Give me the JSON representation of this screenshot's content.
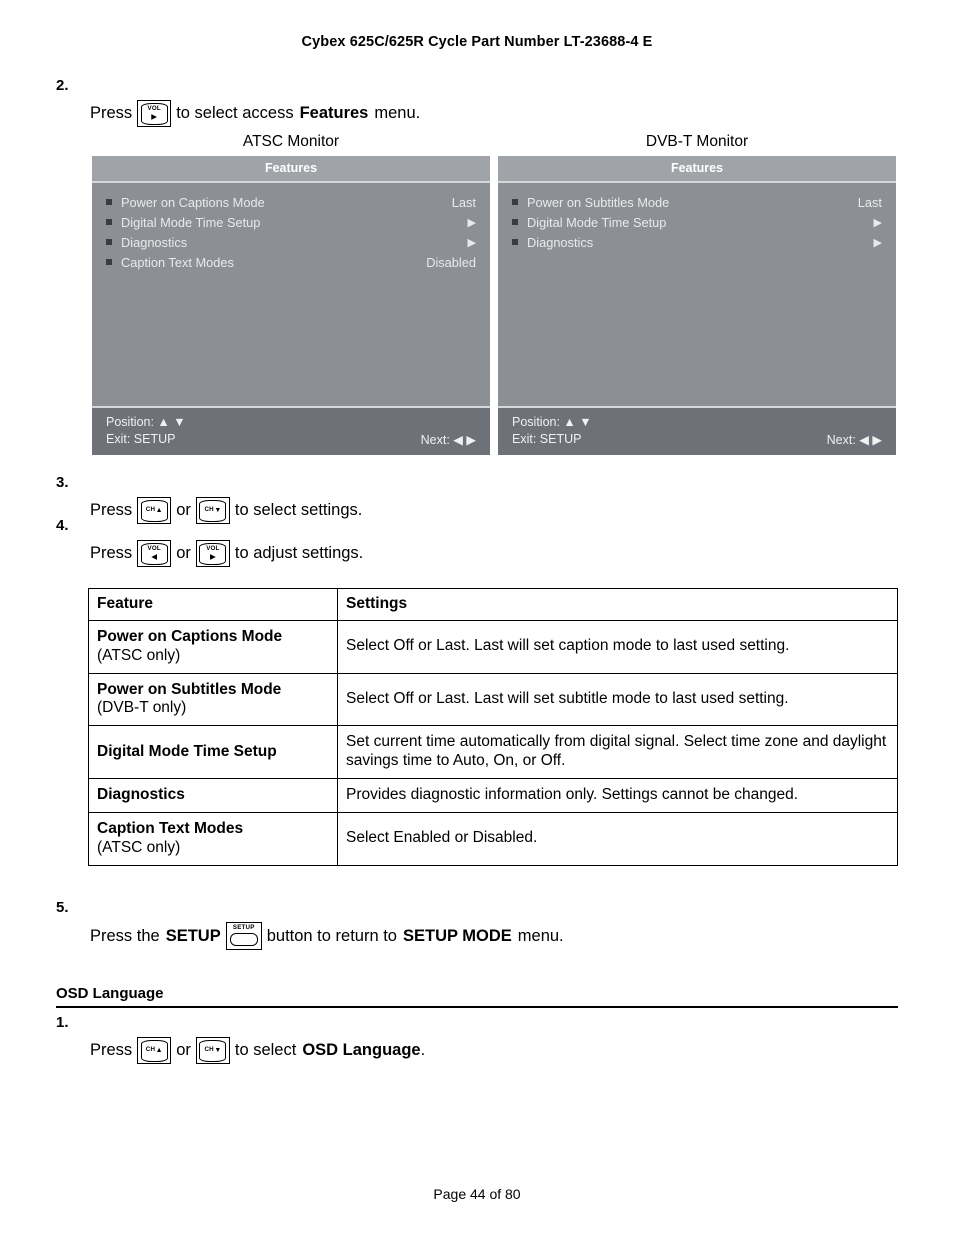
{
  "header": {
    "title": "Cybex 625C/625R Cycle Part Number LT-23688-4 E"
  },
  "footer": {
    "page_label": "Page 44 of 80"
  },
  "steps": {
    "step2": {
      "number": "2.",
      "text_before": "Press",
      "text_after_1": "to select access",
      "bold_term": "Features",
      "text_after_2": "menu.",
      "key": {
        "label": "VOL",
        "arrow": "▶",
        "name": "vol-right"
      }
    },
    "step3": {
      "number": "3.",
      "text_before": "Press",
      "conjunction": "or",
      "text_after": "to select settings.",
      "key1": {
        "label": "CH",
        "arrow": "▲",
        "name": "channel-up"
      },
      "key2": {
        "label": "CH",
        "arrow": "▼",
        "name": "channel-down"
      }
    },
    "step4": {
      "number": "4.",
      "text_before": "Press",
      "conjunction": "or",
      "text_after": "to adjust settings.",
      "key1": {
        "label": "VOL",
        "arrow": "◀",
        "name": "vol-left"
      },
      "key2": {
        "label": "VOL",
        "arrow": "▶",
        "name": "vol-right"
      }
    },
    "step5": {
      "number": "5.",
      "text_before": "Press the",
      "bold_term_1": "SETUP",
      "text_middle": "button to return to",
      "bold_term_2": "SETUP MODE",
      "text_after": "menu.",
      "key": {
        "label": "SETUP",
        "name": "setup-button"
      }
    },
    "osd_step1": {
      "number": "1.",
      "text_before": "Press",
      "conjunction": "or",
      "text_after_1": "to select",
      "bold_term": "OSD Language",
      "text_after_2": ".",
      "key1": {
        "label": "CH",
        "arrow": "▲",
        "name": "channel-up"
      },
      "key2": {
        "label": "CH",
        "arrow": "▼",
        "name": "channel-down"
      }
    }
  },
  "monitors": [
    {
      "title": "ATSC Monitor",
      "menu_title": "Features",
      "rows": [
        {
          "label": "Power on Captions Mode",
          "value": "Last",
          "is_arrow": false
        },
        {
          "label": "Digital Mode Time Setup",
          "value": "▶",
          "is_arrow": true
        },
        {
          "label": "Diagnostics",
          "value": "▶",
          "is_arrow": true
        },
        {
          "label": "Caption Text Modes",
          "value": "Disabled",
          "is_arrow": false
        }
      ],
      "footer": {
        "position_label": "Position: ▲ ▼",
        "exit_label": "Exit: SETUP",
        "next_label": "Next: ◀ ▶"
      }
    },
    {
      "title": "DVB-T Monitor",
      "menu_title": "Features",
      "rows": [
        {
          "label": "Power on Subtitles Mode",
          "value": "Last",
          "is_arrow": false
        },
        {
          "label": "Digital Mode Time Setup",
          "value": "▶",
          "is_arrow": true
        },
        {
          "label": "Diagnostics",
          "value": "▶",
          "is_arrow": true
        }
      ],
      "footer": {
        "position_label": "Position: ▲ ▼",
        "exit_label": "Exit: SETUP",
        "next_label": "Next: ◀ ▶"
      }
    }
  ],
  "settings_table": {
    "headers": [
      "Feature",
      "Settings"
    ],
    "rows": [
      {
        "feature": "Power on Captions Mode",
        "feature_sub": "(ATSC only)",
        "settings": "Select Off or Last. Last will set caption mode to last used setting."
      },
      {
        "feature": "Power on Subtitles Mode",
        "feature_sub": "(DVB-T only)",
        "settings": "Select Off or Last. Last will set subtitle mode to last used setting."
      },
      {
        "feature": "Digital Mode Time Setup",
        "feature_sub": "",
        "settings": "Set current time automatically from digital signal. Select time zone and daylight savings time to Auto, On, or Off."
      },
      {
        "feature": "Diagnostics",
        "feature_sub": "",
        "settings": "Provides diagnostic information only. Settings cannot be changed."
      },
      {
        "feature": "Caption Text Modes",
        "feature_sub": "(ATSC only)",
        "settings": "Select Enabled or Disabled."
      }
    ]
  },
  "osd_language_section": {
    "heading": "OSD Language"
  },
  "colors": {
    "osd_body": "#8c8f94",
    "osd_header": "#a0a3a8",
    "osd_footer": "#6e7177",
    "osd_divider": "#d6d7da",
    "osd_text": "#e9eaec"
  }
}
